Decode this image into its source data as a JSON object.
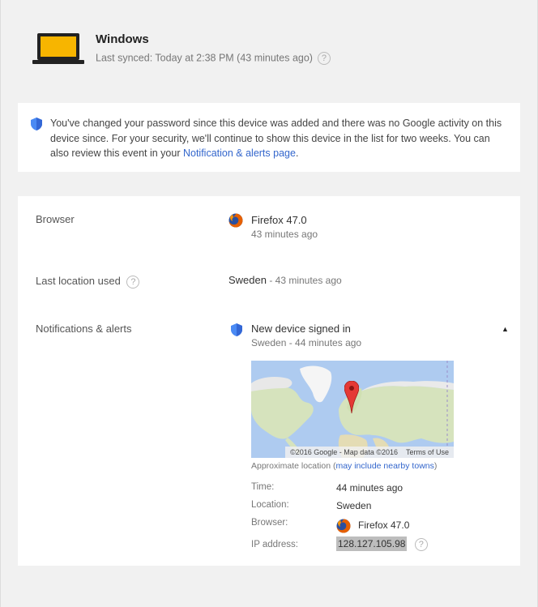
{
  "device": {
    "name": "Windows",
    "last_synced": "Last synced: Today at 2:38 PM (43 minutes ago)",
    "help_glyph": "?"
  },
  "notice": {
    "text": "You've changed your password since this device was added and there was no Google activity on this device since. For your security, we'll continue to show this device in the list for two weeks. You can also review this event in your ",
    "link_label": "Notification & alerts page",
    "trailing": "."
  },
  "details": {
    "browser_label": "Browser",
    "browser_name": "Firefox 47.0",
    "browser_time": "43 minutes ago",
    "location_label": "Last location used",
    "location_value": "Sweden",
    "location_time": " - 43 minutes ago",
    "alerts_label": "Notifications & alerts"
  },
  "alert": {
    "title": "New device signed in",
    "subtitle": "Sweden - 44 minutes ago",
    "map_attribution": "©2016 Google - Map data ©2016",
    "map_terms": "Terms of Use",
    "approx_prefix": "Approximate location (",
    "approx_link": "may include nearby towns",
    "approx_suffix": ")",
    "fields": {
      "time_label": "Time:",
      "time_value": "44 minutes ago",
      "location_label": "Location:",
      "location_value": "Sweden",
      "browser_label": "Browser:",
      "browser_value": "Firefox 47.0",
      "ip_label": "IP address:",
      "ip_value": "128.127.105.98"
    }
  },
  "colors": {
    "link": "#3366cc",
    "shield": "#4a8af4",
    "laptop_screen": "#f7b500",
    "map_pin": "#e53935"
  }
}
